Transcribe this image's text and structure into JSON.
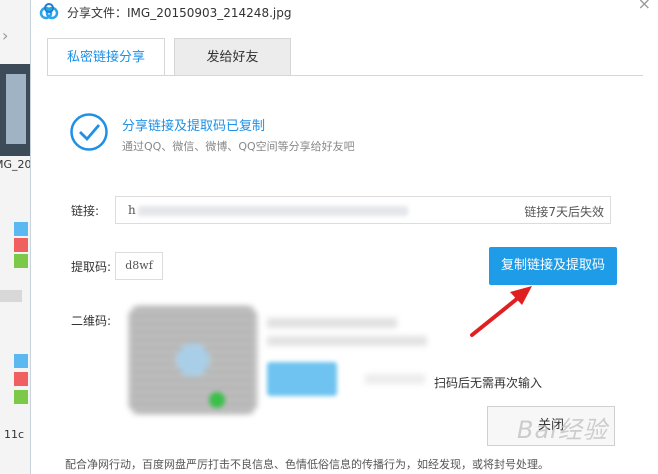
{
  "dialog": {
    "title": "分享文件：IMG_20150903_214248.jpg"
  },
  "background": {
    "file_label_1": "MG_2015",
    "file_label_2": "11c"
  },
  "tabs": [
    {
      "label": "私密链接分享",
      "active": true
    },
    {
      "label": "发给好友",
      "active": false
    }
  ],
  "status": {
    "title": "分享链接及提取码已复制",
    "subtitle": "通过QQ、微信、微博、QQ空间等分享给好友吧"
  },
  "link": {
    "label": "链接:",
    "value_prefix": "h",
    "expire_text": "链接7天后失效"
  },
  "code": {
    "label": "提取码:",
    "value": "d8wf"
  },
  "copy_button": {
    "label": "复制链接及提取码"
  },
  "qr": {
    "label": "二维码:",
    "hint": "扫码后无需再次输入"
  },
  "close_button": {
    "label": "关闭"
  },
  "watermark": "Bai经验",
  "footer": "配合净网行动，百度网盘严厉打击不良信息、色情低俗信息的传播行为，如经发现，或将封号处理。",
  "colors": {
    "accent": "#1e90e6",
    "button": "#1e9ce8",
    "arrow": "#e02020"
  }
}
